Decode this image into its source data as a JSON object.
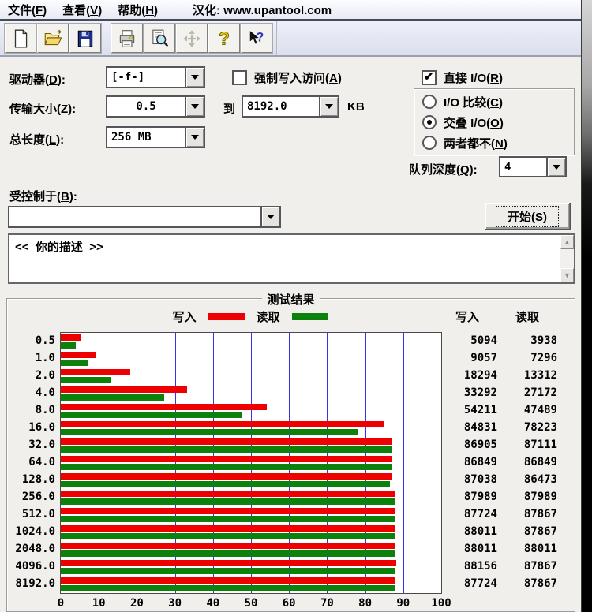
{
  "menu": {
    "items": [
      {
        "label": "文件(F)"
      },
      {
        "label": "查看(V)"
      },
      {
        "label": "帮助(H)"
      }
    ],
    "localization_note": "汉化: www.upantool.com"
  },
  "toolbar": {
    "buttons": [
      "new-file-icon",
      "open-file-icon",
      "save-icon",
      "print-icon",
      "print-preview-icon",
      "move-icon",
      "help-icon",
      "context-help-icon"
    ]
  },
  "form": {
    "drive_label": "驱动器(D):",
    "drive_value": "[-f-]",
    "force_write_label": "强制写入访问(A)",
    "force_write_checked": false,
    "direct_io_label": "直接 I/O(R)",
    "direct_io_checked": true,
    "transfer_label": "传输大小(Z):",
    "transfer_from": "0.5",
    "to_label": "到",
    "transfer_to": "8192.0",
    "unit_label": "KB",
    "io_options": [
      {
        "label": "I/O 比较(C)",
        "selected": false
      },
      {
        "label": "交叠 I/O(O)",
        "selected": true
      },
      {
        "label": "两者都不(N)",
        "selected": false
      }
    ],
    "total_label": "总长度(L):",
    "total_value": "256 MB",
    "queue_label": "队列深度(Q):",
    "queue_value": "4",
    "controlled_label": "受控制于(B):",
    "controlled_value": "",
    "start_button": "开始(S)",
    "description": "<<  你的描述  >>"
  },
  "results": {
    "group_title": "测试结果",
    "legend": [
      {
        "label": "写入",
        "color": "#ee0000"
      },
      {
        "label": "读取",
        "color": "#0c820c"
      }
    ],
    "col_headers": {
      "write": "写入",
      "read": "读取"
    }
  },
  "chart_data": {
    "type": "bar",
    "orientation": "horizontal",
    "title": "测试结果",
    "categories": [
      "0.5",
      "1.0",
      "2.0",
      "4.0",
      "8.0",
      "16.0",
      "32.0",
      "64.0",
      "128.0",
      "256.0",
      "512.0",
      "1024.0",
      "2048.0",
      "4096.0",
      "8192.0"
    ],
    "series": [
      {
        "name": "写入",
        "color": "#ee0000",
        "values": [
          5094,
          9057,
          18294,
          33292,
          54211,
          84831,
          86905,
          86849,
          87038,
          87989,
          87724,
          88011,
          88011,
          88156,
          87724
        ]
      },
      {
        "name": "读取",
        "color": "#0c820c",
        "values": [
          3938,
          7296,
          13312,
          27172,
          47489,
          78223,
          87111,
          86849,
          86473,
          87989,
          87867,
          87867,
          88011,
          87867,
          87867
        ]
      }
    ],
    "xlim": [
      0,
      100
    ],
    "xticks": [
      "0",
      "10",
      "20",
      "30",
      "40",
      "50",
      "60",
      "70",
      "80",
      "90",
      "100"
    ],
    "gridlines": true,
    "legend_position": "top",
    "axis_note": "KB/s values plotted as value/1000 on 0-100 axis"
  }
}
